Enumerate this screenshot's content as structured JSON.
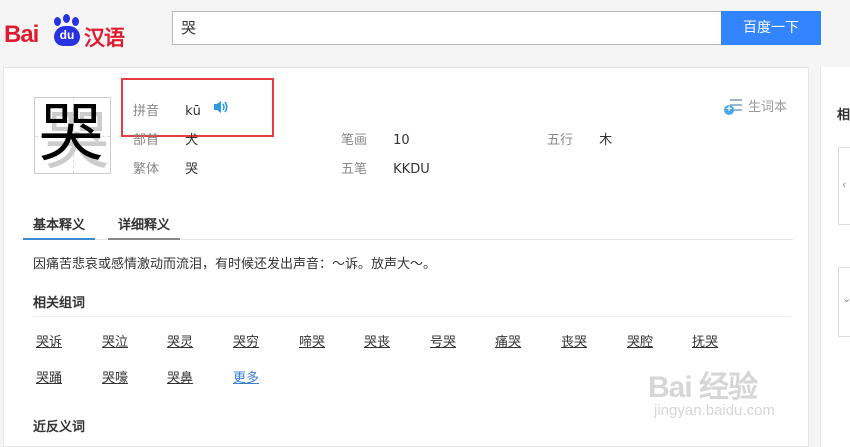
{
  "header": {
    "logo_text_bai": "Bai",
    "logo_text_du": "du",
    "logo_text_cn": "汉语",
    "search_value": "哭",
    "search_button": "百度一下"
  },
  "entry": {
    "character": "哭",
    "pinyin_label": "拼音",
    "pinyin_value": "kū",
    "radical_label": "部首",
    "radical_value": "犬",
    "strokes_label": "笔画",
    "strokes_value": "10",
    "wuxing_label": "五行",
    "wuxing_value": "木",
    "traditional_label": "繁体",
    "traditional_value": "哭",
    "wubi_label": "五笔",
    "wubi_value": "KKDU",
    "vocab_button": "生词本"
  },
  "tabs": [
    {
      "label": "基本释义"
    },
    {
      "label": "详细释义"
    }
  ],
  "definition": "因痛苦悲哀或感情激动而流泪，有时候还发出声音：～诉。放声大～。",
  "related": {
    "title": "相关组词",
    "words_row1": [
      "哭诉",
      "哭泣",
      "哭灵",
      "哭穷",
      "啼哭",
      "哭丧",
      "号哭",
      "痛哭",
      "丧哭",
      "哭腔",
      "抚哭"
    ],
    "words_row2": [
      "哭踊",
      "哭嚎",
      "哭鼻",
      "更多"
    ]
  },
  "antonyms_title": "近反义词",
  "sidebar": {
    "label": "相"
  },
  "watermark": {
    "line1": "Bai 经验",
    "line2": "jingyan.baidu.com"
  },
  "colors": {
    "brand_red": "#de1c31",
    "brand_blue": "#2932e1",
    "button_blue": "#3385ff",
    "highlight_red": "#e53e3e"
  }
}
